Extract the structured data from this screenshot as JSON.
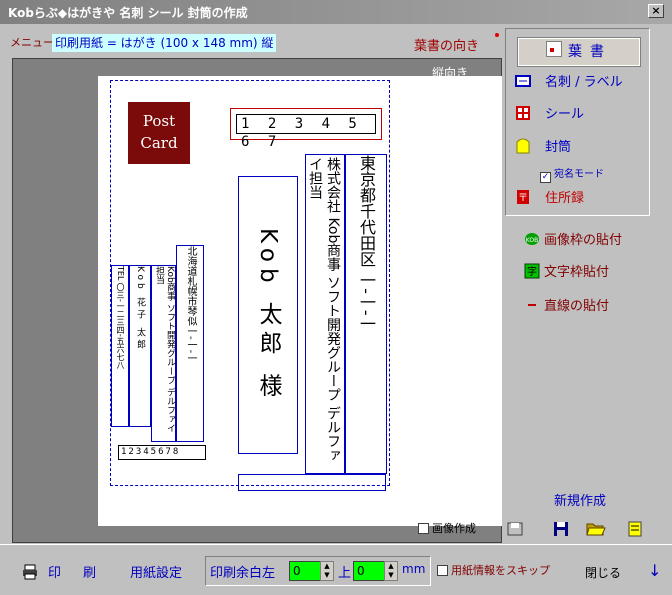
{
  "window": {
    "title": "Kobらぶ◆はがきや 名刺 シール 封筒の作成",
    "close": "×"
  },
  "menu": {
    "label": "メニュー",
    "paper_setting": "印刷用紙 = はがき (100 x 148 mm) 縦"
  },
  "orientation": {
    "label": "葉書の向き",
    "current": "縦向き"
  },
  "postcard": {
    "stamp": [
      "Post",
      "Card"
    ],
    "zip": "1 2 3 4 5 6 7",
    "recipient_name": "Kob 太郎 様",
    "recipient_address": "東京都千代田区 一-一-一",
    "recipient_company": "株式会社 Kob商事 ソフト開発グループ デルファイ担当",
    "sender_address": "北海道札幌市琴似一-一-一",
    "sender_company": "Kob商事 ソフト開発グループ デルファイ担当",
    "sender_name": "Kob 花子 太郎",
    "sender_tel": "TEL 〇三-一二三四-五六七八",
    "sender_zip": "12345678"
  },
  "canvas": {
    "image_create": "画像作成"
  },
  "side_panel": {
    "card": "葉書",
    "meishi": "名刺 / ラベル",
    "seal": "シール",
    "envelope": "封筒",
    "address_mode": "宛名モード",
    "address_book": "住所録"
  },
  "actions": {
    "paste_image": "画像枠の貼付",
    "paste_text": "文字枠貼付",
    "paste_line": "直線の貼付",
    "new": "新規作成"
  },
  "toolbar": {
    "print1": "印",
    "print2": "刷",
    "paper_setup": "用紙設定",
    "margin_left_label": "印刷余白左",
    "margin_left_value": "0",
    "margin_top_label": "上",
    "margin_top_value": "0",
    "margin_unit": "mm",
    "skip_paper": "用紙情報をスキップ",
    "close": "閉じる",
    "down_arrow": "↓"
  },
  "icons": {
    "printer": "printer-icon",
    "card": "card-icon",
    "meishi": "meishi-icon",
    "seal": "seal-icon",
    "envelope": "envelope-icon",
    "address": "address-book-icon"
  },
  "colors": {
    "accent": "#0000c0",
    "stamp": "#7b0a0a",
    "highlight": "#00ff00"
  }
}
